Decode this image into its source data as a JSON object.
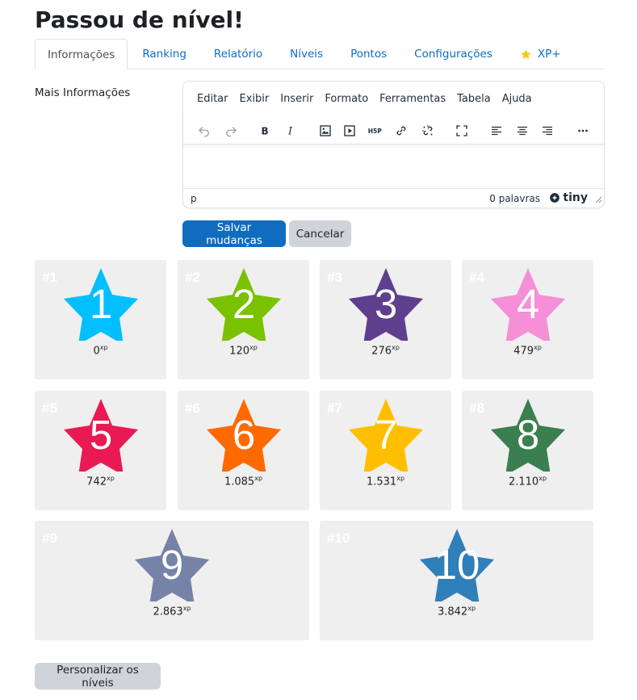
{
  "page": {
    "title": "Passou de nível!"
  },
  "tabs": [
    {
      "label": "Informações",
      "active": true
    },
    {
      "label": "Ranking"
    },
    {
      "label": "Relatório"
    },
    {
      "label": "Níveis"
    },
    {
      "label": "Pontos"
    },
    {
      "label": "Configurações"
    },
    {
      "label": "XP+",
      "icon": "star-icon"
    }
  ],
  "form": {
    "label": "Mais Informações",
    "save_label": "Salvar mudanças",
    "cancel_label": "Cancelar"
  },
  "editor": {
    "menu": [
      "Editar",
      "Exibir",
      "Inserir",
      "Formato",
      "Ferramentas",
      "Tabela",
      "Ajuda"
    ],
    "toolbar": [
      "undo-icon",
      "redo-icon",
      "bold-icon",
      "italic-icon",
      "image-icon",
      "media-icon",
      "h5p-icon",
      "link-icon",
      "unlink-icon",
      "fullscreen-icon",
      "align-left-icon",
      "align-center-icon",
      "align-right-icon",
      "more-icon"
    ],
    "h5p_label": "H5P",
    "status_path": "p",
    "word_count": "0 palavras",
    "brand": "tiny"
  },
  "levels": [
    {
      "tag": "#1",
      "number": "1",
      "xp": "0",
      "unit": "xp",
      "color": "#00bfff"
    },
    {
      "tag": "#2",
      "number": "2",
      "xp": "120",
      "unit": "xp",
      "color": "#7ac100"
    },
    {
      "tag": "#3",
      "number": "3",
      "xp": "276",
      "unit": "xp",
      "color": "#5e3f8e"
    },
    {
      "tag": "#4",
      "number": "4",
      "xp": "479",
      "unit": "xp",
      "color": "#f48fd8"
    },
    {
      "tag": "#5",
      "number": "5",
      "xp": "742",
      "unit": "xp",
      "color": "#e91a53"
    },
    {
      "tag": "#6",
      "number": "6",
      "xp": "1.085",
      "unit": "xp",
      "color": "#ff6a00"
    },
    {
      "tag": "#7",
      "number": "7",
      "xp": "1.531",
      "unit": "xp",
      "color": "#ffbf00"
    },
    {
      "tag": "#8",
      "number": "8",
      "xp": "2.110",
      "unit": "xp",
      "color": "#3a7f4f"
    },
    {
      "tag": "#9",
      "number": "9",
      "xp": "2.863",
      "unit": "xp",
      "color": "#7682a8"
    },
    {
      "tag": "#10",
      "number": "10",
      "xp": "3.842",
      "unit": "xp",
      "color": "#2f7fb9"
    }
  ],
  "customize_label": "Personalizar os níveis"
}
